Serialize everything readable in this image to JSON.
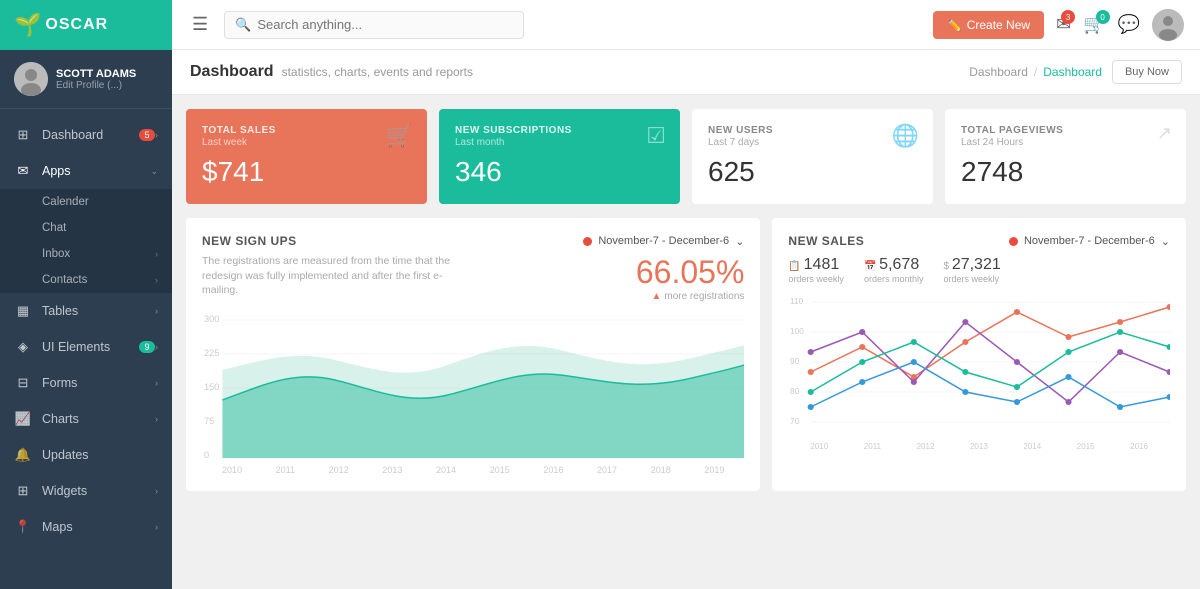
{
  "logo": {
    "text": "OSCAR"
  },
  "user": {
    "name": "SCOTT ADAMS",
    "edit": "Edit Profile (...)"
  },
  "topbar": {
    "search_placeholder": "Search anything...",
    "create_btn": "Create New",
    "mail_badge": "3",
    "cart_badge": "0",
    "chat_icon": true
  },
  "breadcrumb": {
    "parent": "Dashboard",
    "sep": "/",
    "current": "Dashboard"
  },
  "buy_btn": "Buy Now",
  "page": {
    "title": "Dashboard",
    "subtitle": "statistics, charts, events and reports"
  },
  "stats": [
    {
      "label": "TOTAL SALES",
      "sublabel": "Last week",
      "value": "$741",
      "type": "orange"
    },
    {
      "label": "NEW SUBSCRIPTIONS",
      "sublabel": "Last month",
      "value": "346",
      "type": "teal"
    },
    {
      "label": "NEW USERS",
      "sublabel": "Last 7 days",
      "value": "625",
      "type": "white"
    },
    {
      "label": "TOTAL PAGEVIEWS",
      "sublabel": "Last 24 Hours",
      "value": "2748",
      "type": "white"
    }
  ],
  "signups_chart": {
    "title": "NEW SIGN UPS",
    "date_range": "November-7 - December-6",
    "desc": "The registrations are measured from the time that the redesign was fully implemented and after the first e-mailing.",
    "big_value": "66.05%",
    "big_sub": "more registrations",
    "x_labels": [
      "2010",
      "2011",
      "2012",
      "2013",
      "2014",
      "2015",
      "2016",
      "2017",
      "2018",
      "2019"
    ],
    "y_labels": [
      "300",
      "225",
      "150",
      "75",
      "0"
    ]
  },
  "sales_chart": {
    "title": "NEW SALES",
    "date_range": "November-7 - December-6",
    "stats": [
      {
        "icon": "📋",
        "value": "1481",
        "label": "orders weekly"
      },
      {
        "icon": "📅",
        "value": "5,678",
        "label": "orders monthly"
      },
      {
        "icon": "$",
        "value": "27,321",
        "label": "orders weekly"
      }
    ],
    "y_labels": [
      "110",
      "100",
      "90",
      "80",
      "70"
    ],
    "x_labels": [
      "2010",
      "2011",
      "2012",
      "2013",
      "2014",
      "2015",
      "2016"
    ]
  },
  "sidebar": {
    "items": [
      {
        "id": "dashboard",
        "label": "Dashboard",
        "badge": "5",
        "has_chevron": true
      },
      {
        "id": "apps",
        "label": "Apps",
        "badge": null,
        "has_chevron": true,
        "expanded": true,
        "sub_items": [
          {
            "id": "calender",
            "label": "Calender",
            "has_chevron": false
          },
          {
            "id": "chat",
            "label": "Chat",
            "has_chevron": false
          },
          {
            "id": "inbox",
            "label": "Inbox",
            "has_chevron": true
          },
          {
            "id": "contacts",
            "label": "Contacts",
            "has_chevron": true
          }
        ]
      },
      {
        "id": "tables",
        "label": "Tables",
        "badge": null,
        "has_chevron": true
      },
      {
        "id": "ui-elements",
        "label": "UI Elements",
        "badge": "9",
        "badge_teal": true,
        "has_chevron": true
      },
      {
        "id": "forms",
        "label": "Forms",
        "badge": null,
        "has_chevron": true
      },
      {
        "id": "charts",
        "label": "Charts",
        "badge": null,
        "has_chevron": true
      },
      {
        "id": "updates",
        "label": "Updates",
        "badge": null,
        "has_chevron": false
      },
      {
        "id": "widgets",
        "label": "Widgets",
        "badge": null,
        "has_chevron": true
      },
      {
        "id": "maps",
        "label": "Maps",
        "badge": null,
        "has_chevron": true
      }
    ]
  }
}
